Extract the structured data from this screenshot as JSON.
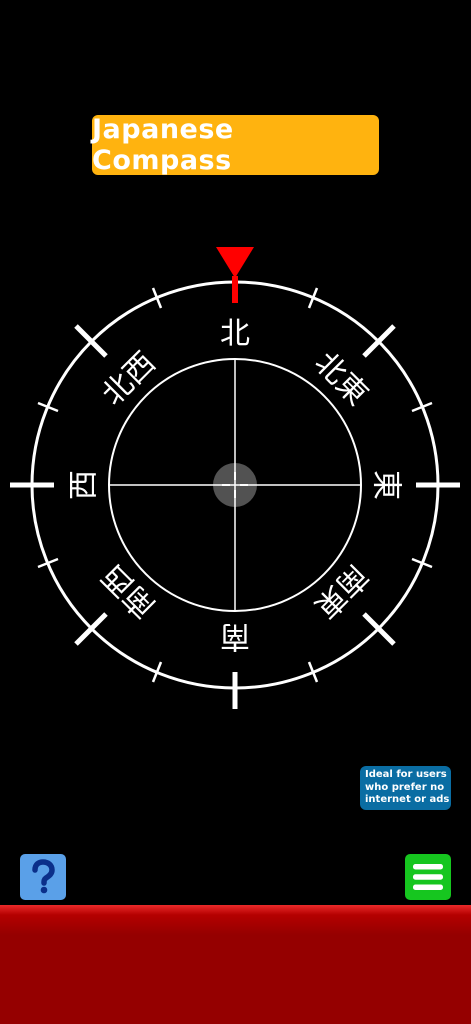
{
  "app": {
    "title": "Japanese Compass"
  },
  "compass": {
    "heading_marker_color": "#ff0000",
    "directions": {
      "north": "北",
      "northeast": "北東",
      "east": "東",
      "southeast": "南東",
      "south": "南",
      "southwest": "南西",
      "west": "西",
      "northwest": "北西"
    }
  },
  "info_badge": {
    "line1": "Ideal for users",
    "line2": "who prefer no",
    "line3": "internet or ads"
  },
  "buttons": {
    "help_icon": "question-icon",
    "menu_icon": "hamburger-menu-icon"
  },
  "colors": {
    "title_bg": "#ffb30f",
    "badge_bg": "#0a6da3",
    "help_bg": "#5aa0e8",
    "menu_bg": "#16c61f",
    "bottom_bar": "#950000"
  }
}
